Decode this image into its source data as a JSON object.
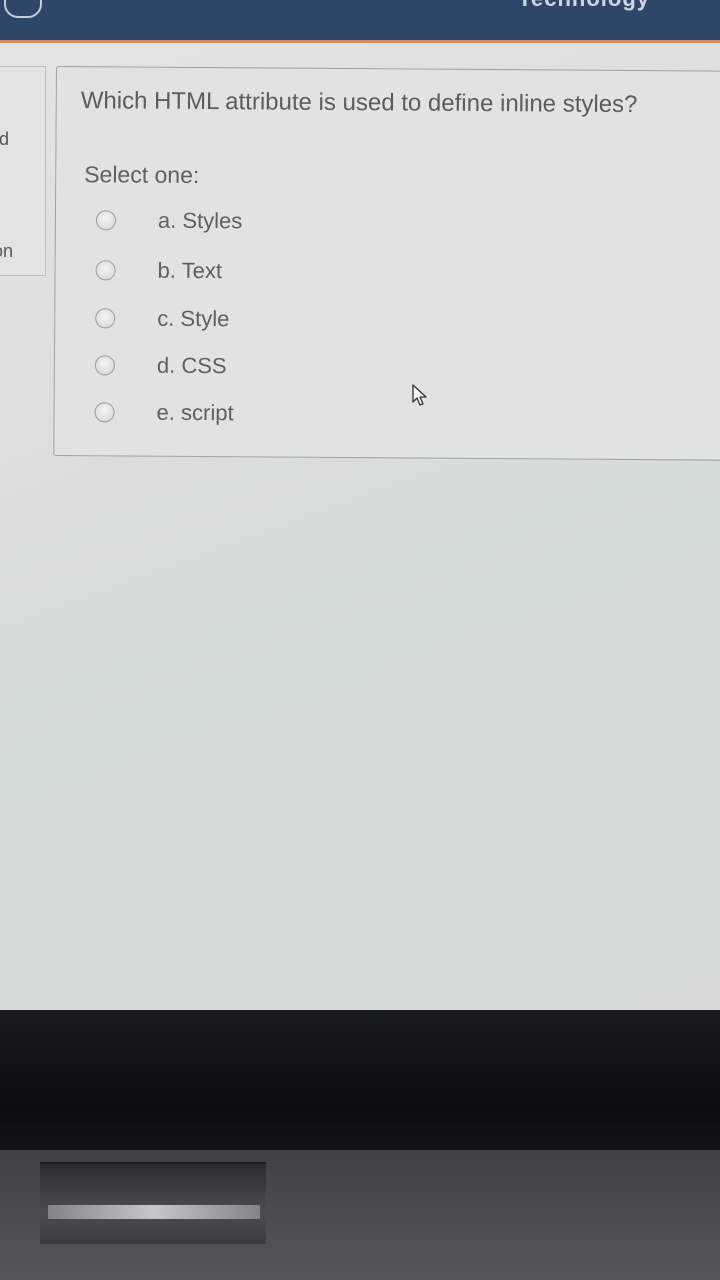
{
  "header": {
    "title": "Technology"
  },
  "left_panel": {
    "text1": "ed",
    "text2": "ion"
  },
  "question": {
    "text": "Which HTML attribute is used to define inline styles?",
    "select_label": "Select one:",
    "options": [
      {
        "label": "a. Styles"
      },
      {
        "label": "b. Text"
      },
      {
        "label": "c. Style"
      },
      {
        "label": "d. CSS"
      },
      {
        "label": "e. script"
      }
    ]
  },
  "icons": {
    "cursor": "mouse-pointer-icon",
    "radio": "radio-button-icon"
  },
  "colors": {
    "header_bg": "#2e4668",
    "header_accent": "#d9895a",
    "text": "#5a5d60"
  }
}
